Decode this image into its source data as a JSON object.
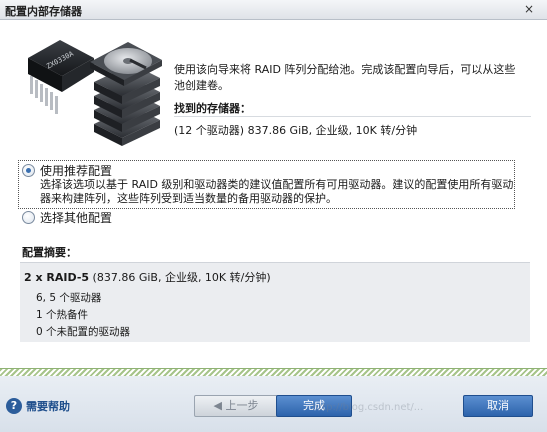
{
  "window": {
    "title": "配置内部存储器",
    "close_glyph": "×"
  },
  "hero": {
    "chip_text": "ZX0330A"
  },
  "intro": {
    "text": "使用该向导来将 RAID 阵列分配给池。完成该配置向导后，可以从这些池创建卷。",
    "found_label": "找到的存储器：",
    "storage_info": "(12 个驱动器) 837.86 GiB, 企业级, 10K 转/分钟"
  },
  "options": {
    "recommended": {
      "label": "使用推荐配置",
      "checked": true,
      "description": "选择该选项以基于 RAID 级别和驱动器类的建议值配置所有可用驱动器。建议的配置使用所有驱动器来构建阵列，这些阵列受到适当数量的备用驱动器的保护。"
    },
    "other": {
      "label": "选择其他配置",
      "checked": false
    }
  },
  "summary": {
    "label": "配置摘要：",
    "head_bold": "2 x RAID-5",
    "head_rest": " (837.86 GiB, 企业级, 10K 转/分钟)",
    "items": [
      "6, 5 个驱动器",
      "1 个热备件",
      "0 个未配置的驱动器"
    ]
  },
  "footer": {
    "help_label": "需要帮助",
    "help_icon_glyph": "?",
    "back_label": "◀ 上一步",
    "finish_label": "完成",
    "cancel_label": "取消",
    "watermark": "http://blog.csdn.net/..."
  },
  "colors": {
    "primary_button": "#2d63ab",
    "summary_bg": "#ebedf0",
    "stripe_green": "#a6c48a",
    "help_link": "#1e4e8c"
  }
}
